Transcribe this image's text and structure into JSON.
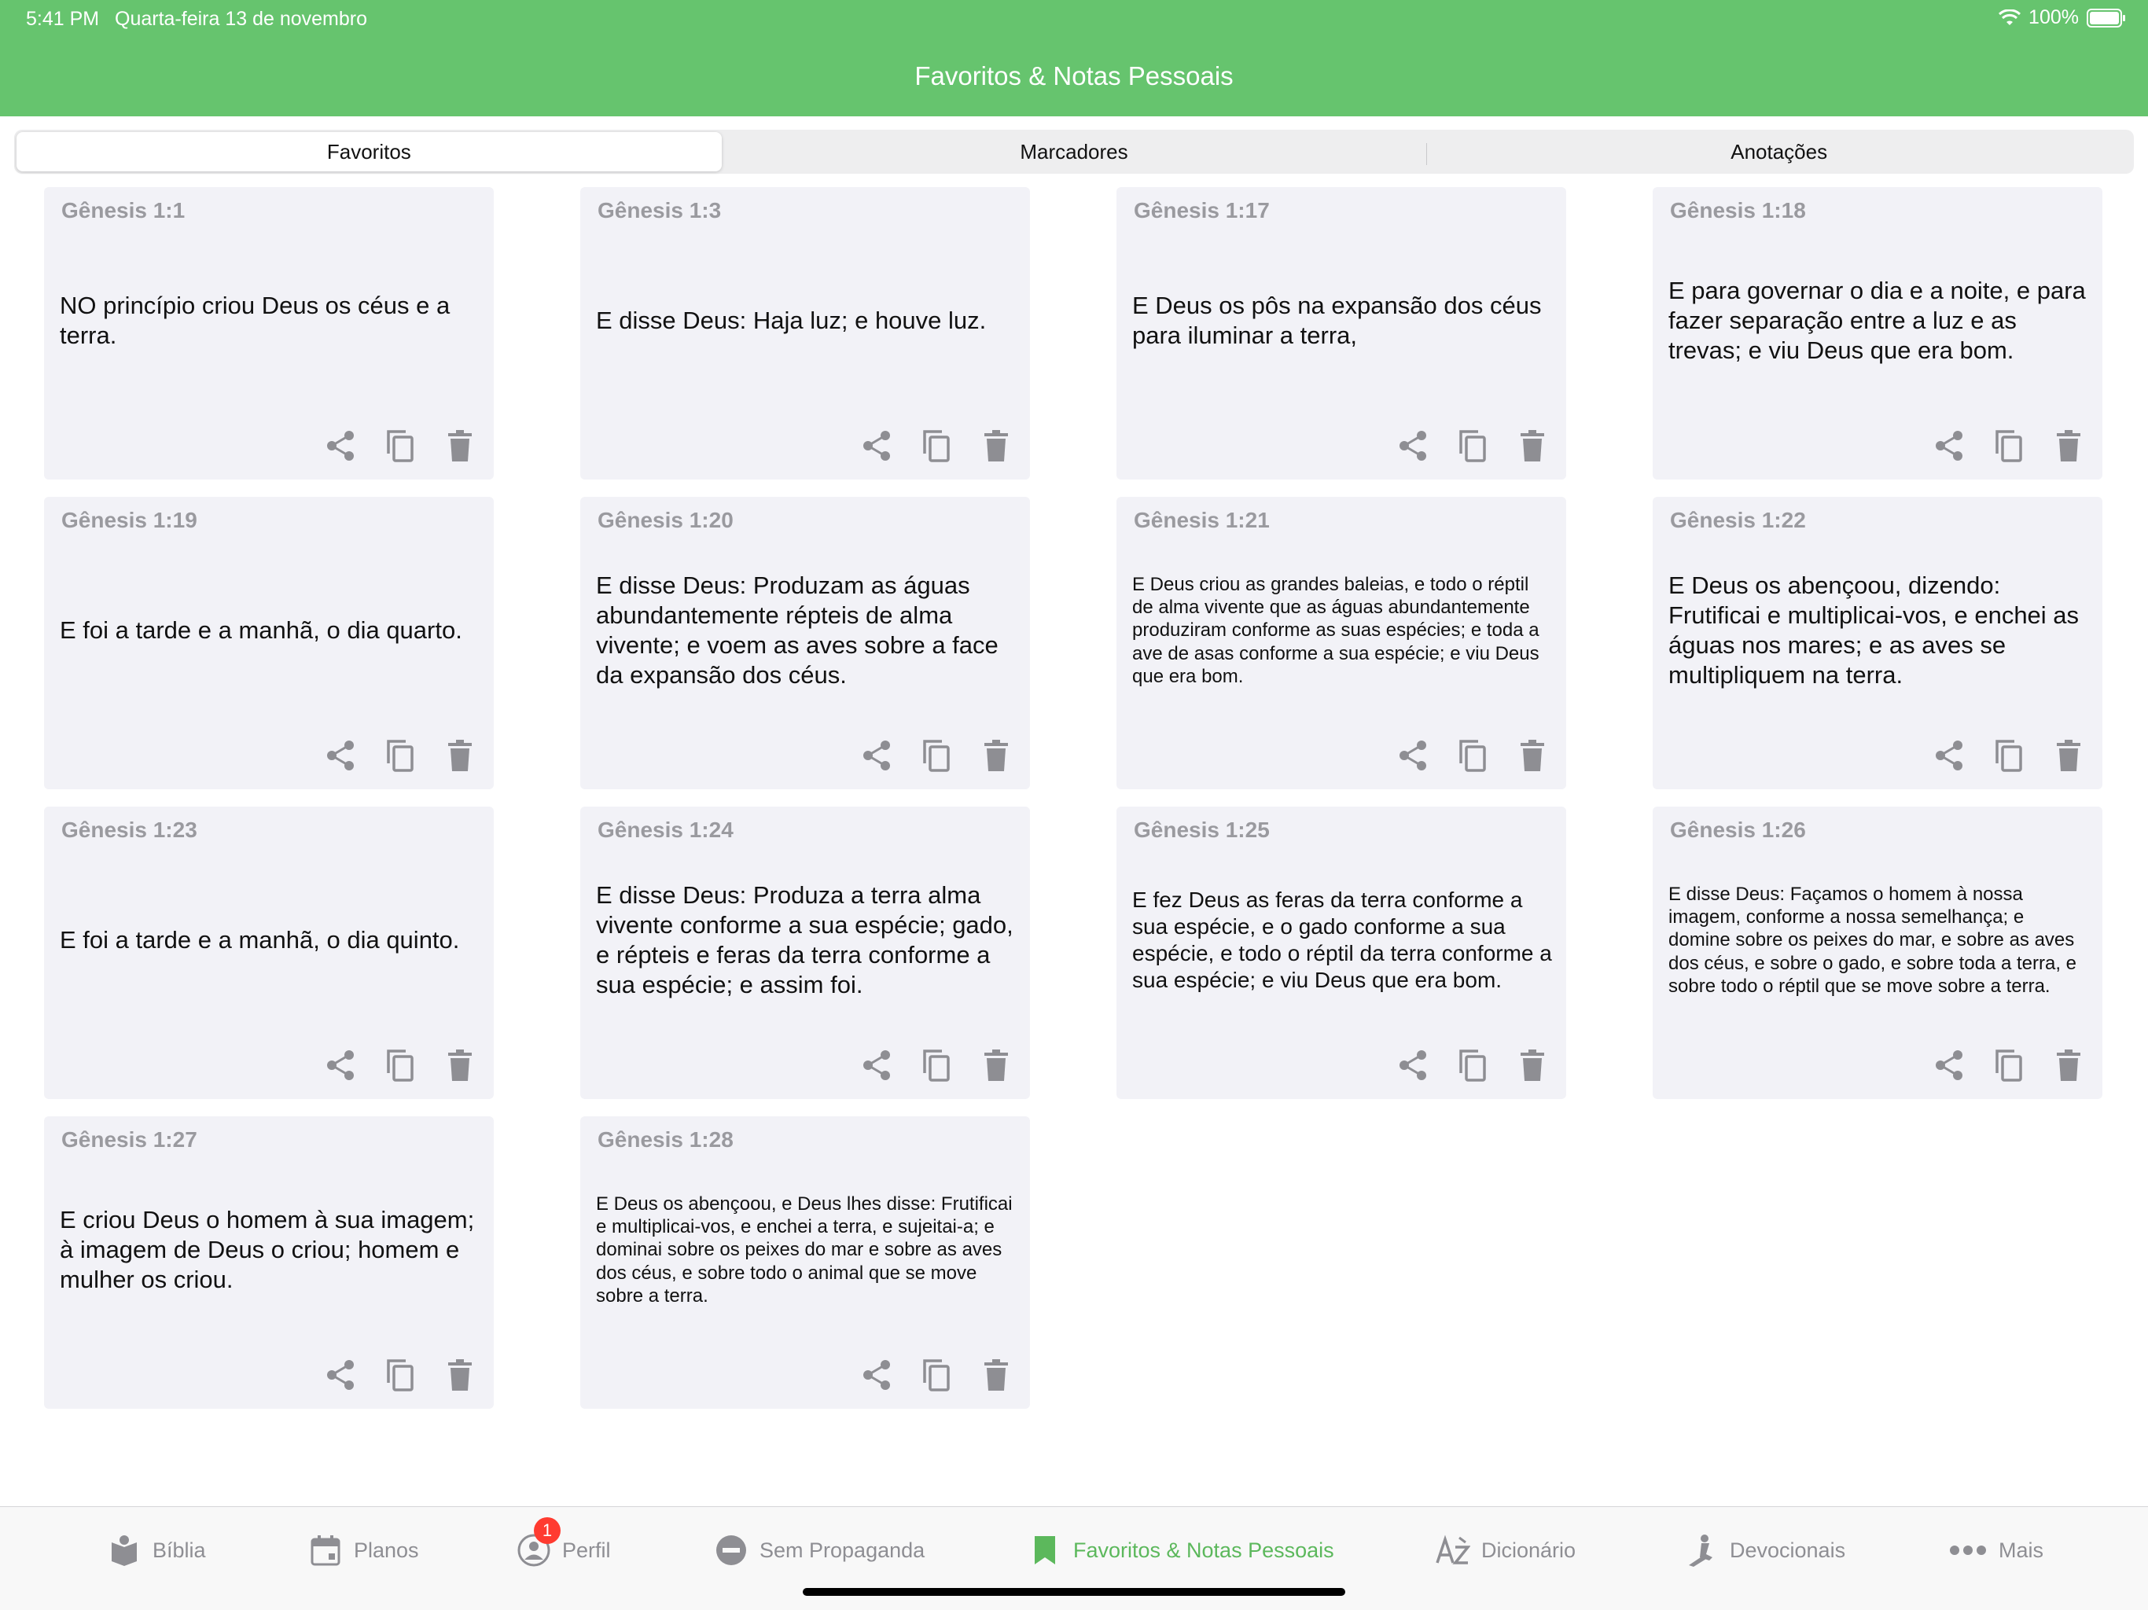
{
  "status": {
    "time": "5:41 PM",
    "date": "Quarta-feira 13 de novembro",
    "battery": "100%"
  },
  "header": {
    "title": "Favoritos & Notas Pessoais"
  },
  "segments": [
    {
      "label": "Favoritos",
      "active": true
    },
    {
      "label": "Marcadores",
      "active": false
    },
    {
      "label": "Anotações",
      "active": false
    }
  ],
  "cards": [
    {
      "ref": "Gênesis 1:1",
      "text": "NO princípio criou Deus os céus e a terra.",
      "size": "large"
    },
    {
      "ref": "Gênesis 1:3",
      "text": "E disse Deus: Haja luz; e houve luz.",
      "size": "large"
    },
    {
      "ref": "Gênesis 1:17",
      "text": "E Deus os pôs na expansão dos céus para iluminar a terra,",
      "size": "large"
    },
    {
      "ref": "Gênesis 1:18",
      "text": "E para governar o dia e a noite, e para fazer separação entre a luz e as trevas; e viu Deus que era bom.",
      "size": "large"
    },
    {
      "ref": "Gênesis 1:19",
      "text": "E foi a tarde e a manhã, o dia quarto.",
      "size": "large"
    },
    {
      "ref": "Gênesis 1:20",
      "text": "E disse Deus: Produzam as águas abundantemente répteis de alma vivente; e voem as aves sobre a face da expansão dos céus.",
      "size": "large"
    },
    {
      "ref": "Gênesis 1:21",
      "text": "E Deus criou as grandes baleias, e todo o réptil de alma vivente que as águas abundantemente produziram conforme as suas espécies; e toda a ave de asas conforme a sua espécie; e viu Deus que era bom.",
      "size": "small"
    },
    {
      "ref": "Gênesis 1:22",
      "text": "E Deus os abençoou, dizendo: Frutificai e multiplicai-vos, e enchei as águas nos mares; e as aves se multipliquem na terra.",
      "size": "large"
    },
    {
      "ref": "Gênesis 1:23",
      "text": "E foi a tarde e a manhã, o dia quinto.",
      "size": "large"
    },
    {
      "ref": "Gênesis 1:24",
      "text": "E disse Deus: Produza a terra alma vivente conforme a sua espécie; gado, e répteis e feras da terra conforme a sua espécie; e assim foi.",
      "size": "large"
    },
    {
      "ref": "Gênesis 1:25",
      "text": "E fez Deus as feras da terra conforme a sua espécie, e o gado conforme a sua espécie, e todo o réptil da terra conforme a sua espécie; e viu Deus que era bom.",
      "size": "medium"
    },
    {
      "ref": "Gênesis 1:26",
      "text": "E disse Deus: Façamos o homem à nossa imagem, conforme a nossa semelhança; e domine sobre os peixes do mar, e sobre as aves dos céus, e sobre o gado, e sobre toda a terra, e sobre todo o réptil que se move sobre a terra.",
      "size": "small"
    },
    {
      "ref": "Gênesis 1:27",
      "text": "E criou Deus o homem à sua imagem; à imagem de Deus o criou; homem e mulher os criou.",
      "size": "large"
    },
    {
      "ref": "Gênesis 1:28",
      "text": "E Deus os abençoou, e Deus lhes disse: Frutificai e multiplicai-vos, e enchei a terra, e sujeitai-a; e dominai sobre os peixes do mar e sobre as aves dos céus, e sobre todo o animal que se move sobre a terra.",
      "size": "small"
    }
  ],
  "card_icons": [
    "share-icon",
    "copy-icon",
    "trash-icon"
  ],
  "tabs": [
    {
      "label": "Bíblia",
      "icon": "bible-icon",
      "active": false
    },
    {
      "label": "Planos",
      "icon": "calendar-icon",
      "active": false
    },
    {
      "label": "Perfil",
      "icon": "profile-icon",
      "active": false,
      "badge": "1"
    },
    {
      "label": "Sem Propaganda",
      "icon": "no-ads-icon",
      "active": false
    },
    {
      "label": "Favoritos & Notas Pessoais",
      "icon": "bookmark-icon",
      "active": true
    },
    {
      "label": "Dicionário",
      "icon": "dictionary-icon",
      "active": false
    },
    {
      "label": "Devocionais",
      "icon": "devotional-icon",
      "active": false
    },
    {
      "label": "Mais",
      "icon": "more-icon",
      "active": false
    }
  ],
  "colors": {
    "header": "#66c46e",
    "active_tab": "#5cb85c",
    "inactive": "#8e8e93",
    "card_bg": "#f2f2f7",
    "badge": "#ff3b30"
  }
}
